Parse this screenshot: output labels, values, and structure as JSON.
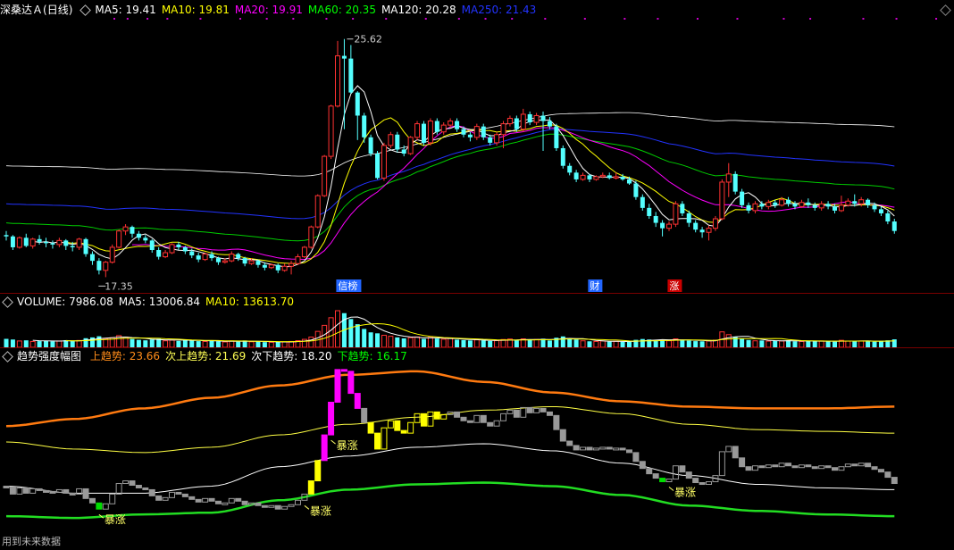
{
  "main_header": {
    "name": "深桑达Ａ",
    "period": "(日线)",
    "ma": [
      {
        "label": "MA5: 19.41",
        "color": "#ffffff"
      },
      {
        "label": "MA10: 19.81",
        "color": "#ffff00"
      },
      {
        "label": "MA20: 19.91",
        "color": "#ff00ff"
      },
      {
        "label": "MA60: 20.35",
        "color": "#00ff00"
      },
      {
        "label": "MA120: 20.28",
        "color": "#ffffff"
      },
      {
        "label": "MA250: 21.43",
        "color": "#2233ff"
      }
    ]
  },
  "volume_header": {
    "items": [
      {
        "label": "VOLUME: 7986.08",
        "color": "#ffffff"
      },
      {
        "label": "MA5: 13006.84",
        "color": "#ffffff"
      },
      {
        "label": "MA10: 13613.70",
        "color": "#ffff00"
      }
    ]
  },
  "trend_header": {
    "title": "趋势强度幅图",
    "items": [
      {
        "label": "上趋势: 23.66",
        "color": "#ff8c1a"
      },
      {
        "label": "次上趋势: 21.69",
        "color": "#ffff55"
      },
      {
        "label": "次下趋势: 18.20",
        "color": "#ffffff"
      },
      {
        "label": "下趋势: 16.17",
        "color": "#00ff00"
      }
    ]
  },
  "footer_text": "用到未来数据",
  "chart_data": {
    "type": "candlestick",
    "price_high_label": "25.62",
    "price_low_label": "17.35",
    "markers": [
      {
        "text": "信榜",
        "color": "#2266ff",
        "index": 51
      },
      {
        "text": "财",
        "color": "#2266ff",
        "index": 89
      },
      {
        "text": "涨",
        "color": "#cc0000",
        "index": 101
      }
    ],
    "surge_label": "暴涨",
    "surge_indices": [
      14,
      45,
      49,
      100
    ],
    "ylim": [
      16.6,
      26.4
    ],
    "candles": [
      [
        18.4,
        18.35,
        18.2,
        18.55
      ],
      [
        18.35,
        17.95,
        17.85,
        18.4
      ],
      [
        17.95,
        18.3,
        17.9,
        18.35
      ],
      [
        18.3,
        18.0,
        17.95,
        18.45
      ],
      [
        18.0,
        18.25,
        17.9,
        18.3
      ],
      [
        18.25,
        18.15,
        18.05,
        18.4
      ],
      [
        18.15,
        18.1,
        17.95,
        18.3
      ],
      [
        18.1,
        18.05,
        17.9,
        18.2
      ],
      [
        18.05,
        18.2,
        17.95,
        18.3
      ],
      [
        18.2,
        18.0,
        17.85,
        18.25
      ],
      [
        18.0,
        17.95,
        17.8,
        18.15
      ],
      [
        17.95,
        18.25,
        17.85,
        18.3
      ],
      [
        18.25,
        17.7,
        17.6,
        18.3
      ],
      [
        17.7,
        17.45,
        17.3,
        17.8
      ],
      [
        17.45,
        17.1,
        16.95,
        17.55
      ],
      [
        17.1,
        17.4,
        16.85,
        17.45
      ],
      [
        17.4,
        17.95,
        17.35,
        18.05
      ],
      [
        17.95,
        18.55,
        17.9,
        18.6
      ],
      [
        18.55,
        18.7,
        18.4,
        18.8
      ],
      [
        18.7,
        18.45,
        18.3,
        18.75
      ],
      [
        18.45,
        18.3,
        18.2,
        18.55
      ],
      [
        18.3,
        18.2,
        18.1,
        18.4
      ],
      [
        18.2,
        17.85,
        17.75,
        18.25
      ],
      [
        17.85,
        17.6,
        17.5,
        17.95
      ],
      [
        17.6,
        17.75,
        17.55,
        17.85
      ],
      [
        17.75,
        18.05,
        17.7,
        18.1
      ],
      [
        18.05,
        17.95,
        17.85,
        18.15
      ],
      [
        17.95,
        17.8,
        17.7,
        18.0
      ],
      [
        17.8,
        17.65,
        17.55,
        17.9
      ],
      [
        17.65,
        17.5,
        17.4,
        17.75
      ],
      [
        17.5,
        17.7,
        17.45,
        17.75
      ],
      [
        17.7,
        17.55,
        17.45,
        17.8
      ],
      [
        17.55,
        17.4,
        17.3,
        17.6
      ],
      [
        17.4,
        17.45,
        17.35,
        17.55
      ],
      [
        17.45,
        17.7,
        17.4,
        17.8
      ],
      [
        17.7,
        17.55,
        17.45,
        17.75
      ],
      [
        17.55,
        17.35,
        17.25,
        17.6
      ],
      [
        17.35,
        17.45,
        17.3,
        17.55
      ],
      [
        17.45,
        17.3,
        17.2,
        17.5
      ],
      [
        17.3,
        17.2,
        17.1,
        17.4
      ],
      [
        17.2,
        17.3,
        17.15,
        17.35
      ],
      [
        17.3,
        17.1,
        17.0,
        17.35
      ],
      [
        17.1,
        17.25,
        17.05,
        17.35
      ],
      [
        17.25,
        17.35,
        16.95,
        17.45
      ],
      [
        17.35,
        17.6,
        17.3,
        17.7
      ],
      [
        17.6,
        17.95,
        17.55,
        18.0
      ],
      [
        17.95,
        18.7,
        17.9,
        18.75
      ],
      [
        18.7,
        19.85,
        18.65,
        19.9
      ],
      [
        19.85,
        21.3,
        19.8,
        21.35
      ],
      [
        21.3,
        23.15,
        21.2,
        23.2
      ],
      [
        23.15,
        25.0,
        23.1,
        25.55
      ],
      [
        25.0,
        24.9,
        22.3,
        25.62
      ],
      [
        24.9,
        23.65,
        23.6,
        25.4
      ],
      [
        23.65,
        22.8,
        21.9,
        23.7
      ],
      [
        22.8,
        22.0,
        21.8,
        22.9
      ],
      [
        22.0,
        21.4,
        21.3,
        22.1
      ],
      [
        21.4,
        20.5,
        20.45,
        21.5
      ],
      [
        20.5,
        21.7,
        20.4,
        21.8
      ],
      [
        21.7,
        22.1,
        21.6,
        22.2
      ],
      [
        22.1,
        21.55,
        21.45,
        22.2
      ],
      [
        21.55,
        21.4,
        21.3,
        21.7
      ],
      [
        21.4,
        22.0,
        21.35,
        22.05
      ],
      [
        22.0,
        22.5,
        21.9,
        22.6
      ],
      [
        22.5,
        21.8,
        21.7,
        22.6
      ],
      [
        21.8,
        22.6,
        21.7,
        22.7
      ],
      [
        22.6,
        22.2,
        22.1,
        22.7
      ],
      [
        22.2,
        22.45,
        22.1,
        22.55
      ],
      [
        22.45,
        22.6,
        22.35,
        22.7
      ],
      [
        22.6,
        22.3,
        22.2,
        22.7
      ],
      [
        22.3,
        22.1,
        22.0,
        22.4
      ],
      [
        22.1,
        22.0,
        21.85,
        22.2
      ],
      [
        22.0,
        22.4,
        21.9,
        22.5
      ],
      [
        22.4,
        22.0,
        21.9,
        22.5
      ],
      [
        22.0,
        21.8,
        21.7,
        22.1
      ],
      [
        21.8,
        22.1,
        21.7,
        22.2
      ],
      [
        22.1,
        22.5,
        21.6,
        22.6
      ],
      [
        22.5,
        22.7,
        22.4,
        22.8
      ],
      [
        22.7,
        22.3,
        22.2,
        22.8
      ],
      [
        22.3,
        22.85,
        22.2,
        23.05
      ],
      [
        22.85,
        22.55,
        22.45,
        22.95
      ],
      [
        22.55,
        22.8,
        22.45,
        22.9
      ],
      [
        22.8,
        22.6,
        21.5,
        22.95
      ],
      [
        22.6,
        22.4,
        22.3,
        22.75
      ],
      [
        22.4,
        21.6,
        21.5,
        22.5
      ],
      [
        21.6,
        20.95,
        20.85,
        21.7
      ],
      [
        20.95,
        20.7,
        20.6,
        21.05
      ],
      [
        20.7,
        20.45,
        20.35,
        20.8
      ],
      [
        20.45,
        20.6,
        20.4,
        20.7
      ],
      [
        20.6,
        20.45,
        20.35,
        20.65
      ],
      [
        20.45,
        20.55,
        20.4,
        20.6
      ],
      [
        20.55,
        20.6,
        20.5,
        20.7
      ],
      [
        20.6,
        20.5,
        20.45,
        20.7
      ],
      [
        20.5,
        20.55,
        20.45,
        20.7
      ],
      [
        20.55,
        20.45,
        20.4,
        20.65
      ],
      [
        20.45,
        20.3,
        20.25,
        20.55
      ],
      [
        20.3,
        19.8,
        19.7,
        20.4
      ],
      [
        19.8,
        19.4,
        19.3,
        19.9
      ],
      [
        19.4,
        19.1,
        19.0,
        19.55
      ],
      [
        19.1,
        18.85,
        18.7,
        19.25
      ],
      [
        18.85,
        18.65,
        18.35,
        18.95
      ],
      [
        18.65,
        18.8,
        18.55,
        18.9
      ],
      [
        18.8,
        19.55,
        18.7,
        19.65
      ],
      [
        19.55,
        19.2,
        19.1,
        19.65
      ],
      [
        19.2,
        18.85,
        18.7,
        19.3
      ],
      [
        18.85,
        18.6,
        18.5,
        18.95
      ],
      [
        18.6,
        18.5,
        18.3,
        18.7
      ],
      [
        18.5,
        18.65,
        18.2,
        18.75
      ],
      [
        18.65,
        19.0,
        18.55,
        19.1
      ],
      [
        19.0,
        20.35,
        18.95,
        20.45
      ],
      [
        20.35,
        20.65,
        19.8,
        21.05
      ],
      [
        20.65,
        20.0,
        19.9,
        20.75
      ],
      [
        20.0,
        19.5,
        19.4,
        20.1
      ],
      [
        19.5,
        19.3,
        19.2,
        19.6
      ],
      [
        19.3,
        19.55,
        19.2,
        19.65
      ],
      [
        19.55,
        19.45,
        19.35,
        19.65
      ],
      [
        19.45,
        19.6,
        19.35,
        19.7
      ],
      [
        19.6,
        19.5,
        19.4,
        19.7
      ],
      [
        19.5,
        19.7,
        19.45,
        19.8
      ],
      [
        19.7,
        19.55,
        19.45,
        19.8
      ],
      [
        19.55,
        19.45,
        19.35,
        19.65
      ],
      [
        19.45,
        19.6,
        19.4,
        19.7
      ],
      [
        19.6,
        19.5,
        19.4,
        19.75
      ],
      [
        19.5,
        19.4,
        19.3,
        19.6
      ],
      [
        19.4,
        19.55,
        19.3,
        19.65
      ],
      [
        19.55,
        19.45,
        19.35,
        19.65
      ],
      [
        19.45,
        19.3,
        19.2,
        19.55
      ],
      [
        19.3,
        19.5,
        19.25,
        19.85
      ],
      [
        19.5,
        19.65,
        19.45,
        19.75
      ],
      [
        19.65,
        19.55,
        19.45,
        19.9
      ],
      [
        19.55,
        19.7,
        19.45,
        19.8
      ],
      [
        19.7,
        19.5,
        19.4,
        19.75
      ],
      [
        19.5,
        19.35,
        19.25,
        19.6
      ],
      [
        19.35,
        19.2,
        19.1,
        19.45
      ],
      [
        19.2,
        18.9,
        18.8,
        19.3
      ],
      [
        18.9,
        18.55,
        18.45,
        19.0
      ]
    ],
    "volumes": [
      5200,
      4800,
      3900,
      4300,
      3600,
      3800,
      4100,
      3700,
      3900,
      4400,
      3800,
      4200,
      5600,
      6100,
      6800,
      5300,
      5900,
      7200,
      6300,
      5100,
      4600,
      4300,
      4800,
      5200,
      4000,
      4400,
      3900,
      4700,
      4200,
      3800,
      3600,
      4100,
      3700,
      3300,
      3900,
      3500,
      4200,
      3400,
      3600,
      3200,
      3100,
      3400,
      3300,
      3600,
      4100,
      4900,
      6300,
      9800,
      13500,
      18200,
      22500,
      21000,
      17400,
      14200,
      11300,
      9200,
      8600,
      7400,
      6800,
      6100,
      5500,
      5900,
      6400,
      5200,
      6100,
      5400,
      5000,
      5600,
      4700,
      4400,
      4200,
      4600,
      4300,
      3900,
      4100,
      4800,
      5100,
      4500,
      5200,
      4600,
      4800,
      5300,
      4200,
      5900,
      6700,
      5300,
      4800,
      4000,
      3700,
      3600,
      3900,
      3500,
      3700,
      3400,
      3300,
      4600,
      5100,
      4800,
      4300,
      4900,
      4000,
      5200,
      4600,
      4100,
      3800,
      3700,
      3900,
      4400,
      9500,
      7800,
      6600,
      5300,
      4500,
      4000,
      4200,
      3800,
      4100,
      3900,
      4300,
      3700,
      3600,
      4000,
      3700,
      3900,
      3600,
      3500,
      4300,
      3800,
      4100,
      3900,
      3700,
      3500,
      3600,
      4300,
      4900
    ],
    "trend": {
      "upper_series": [
        21.8,
        22.2,
        22.8,
        23.4,
        24.1,
        24.7,
        24.9,
        24.3,
        23.7,
        23.2,
        22.9,
        22.8,
        22.8,
        22.9
      ],
      "second_upper_series": [
        20.9,
        20.5,
        20.3,
        20.6,
        21.3,
        21.9,
        22.3,
        22.7,
        22.9,
        22.5,
        21.9,
        21.6,
        21.5,
        21.4
      ],
      "second_lower_series": [
        18.4,
        18.0,
        18.0,
        18.4,
        19.5,
        20.1,
        20.6,
        20.8,
        20.4,
        19.7,
        19.0,
        18.5,
        18.3,
        18.2
      ],
      "lower_series": [
        16.7,
        16.6,
        16.8,
        16.9,
        17.6,
        18.2,
        18.5,
        18.6,
        18.4,
        17.9,
        17.3,
        17.0,
        16.8,
        16.7
      ],
      "ylim": [
        16.1,
        25.6
      ]
    }
  }
}
